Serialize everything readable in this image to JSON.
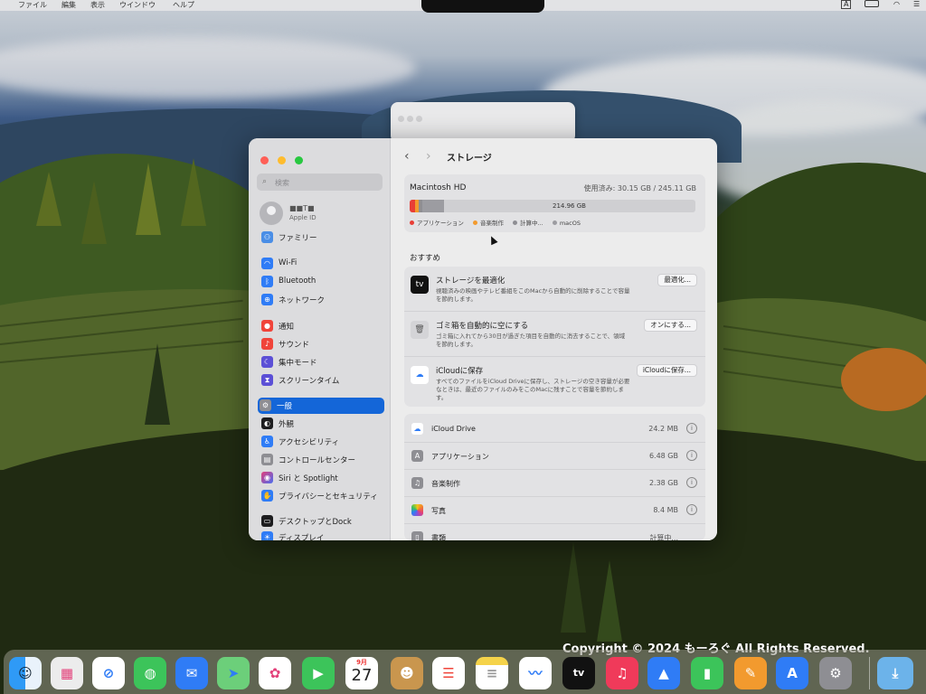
{
  "menubar": {
    "items": [
      "ファイル",
      "編集",
      "表示",
      "ウインドウ",
      "ヘルプ"
    ],
    "input_indicator": "A"
  },
  "sidebar": {
    "search_placeholder": "検索",
    "account": {
      "name": "■■T■",
      "sub": "Apple ID"
    },
    "family": "ファミリー",
    "items": [
      {
        "label": "Wi-Fi",
        "icon": "wifi-icon"
      },
      {
        "label": "Bluetooth",
        "icon": "bluetooth-icon"
      },
      {
        "label": "ネットワーク",
        "icon": "network-icon"
      },
      {
        "label": "通知",
        "icon": "notifications-icon"
      },
      {
        "label": "サウンド",
        "icon": "sound-icon"
      },
      {
        "label": "集中モード",
        "icon": "focus-icon"
      },
      {
        "label": "スクリーンタイム",
        "icon": "screentime-icon"
      },
      {
        "label": "一般",
        "icon": "general-icon",
        "selected": true
      },
      {
        "label": "外観",
        "icon": "appearance-icon"
      },
      {
        "label": "アクセシビリティ",
        "icon": "accessibility-icon"
      },
      {
        "label": "コントロールセンター",
        "icon": "control-center-icon"
      },
      {
        "label": "Siri と Spotlight",
        "icon": "siri-icon"
      },
      {
        "label": "プライバシーとセキュリティ",
        "icon": "privacy-icon"
      },
      {
        "label": "デスクトップとDock",
        "icon": "desktop-dock-icon"
      },
      {
        "label": "ディスプレイ",
        "icon": "display-icon"
      }
    ]
  },
  "main": {
    "title": "ストレージ",
    "disk": {
      "name": "Macintosh HD",
      "used": "使用済み: 30.15 GB / 245.11 GB",
      "free_label": "214.96 GB",
      "legend": [
        "アプリケーション",
        "音楽制作",
        "計算中...",
        "macOS"
      ]
    },
    "section_title": "おすすめ",
    "recommendations": [
      {
        "title": "ストレージを最適化",
        "desc": "視聴済みの映画やテレビ番組をこのMacから自動的に削除することで容量を節約します。",
        "button": "最適化..."
      },
      {
        "title": "ゴミ箱を自動的に空にする",
        "desc": "ゴミ箱に入れてから30日が過ぎた項目を自動的に消去することで、領域を節約します。",
        "button": "オンにする..."
      },
      {
        "title": "iCloudに保存",
        "desc": "すべてのファイルをiCloud Driveに保存し、ストレージの空き容量が必要なときは、最近のファイルのみをこのMacに残すことで容量を節約します。",
        "button": "iCloudに保存..."
      }
    ],
    "usage": [
      {
        "name": "iCloud Drive",
        "size": "24.2 MB"
      },
      {
        "name": "アプリケーション",
        "size": "6.48 GB"
      },
      {
        "name": "音楽制作",
        "size": "2.38 GB"
      },
      {
        "name": "写真",
        "size": "8.4 MB"
      },
      {
        "name": "書類",
        "size": "計算中..."
      }
    ]
  },
  "dock": {
    "calendar_month": "9月",
    "calendar_day": "27",
    "tv_label": "tv"
  },
  "copyright": "Copyright © 2024 もーろぐ All Rights Reserved.",
  "colors": {
    "accent": "#1466d8",
    "red": "#ff5f57",
    "yellow": "#febc2e",
    "green": "#28c840"
  }
}
